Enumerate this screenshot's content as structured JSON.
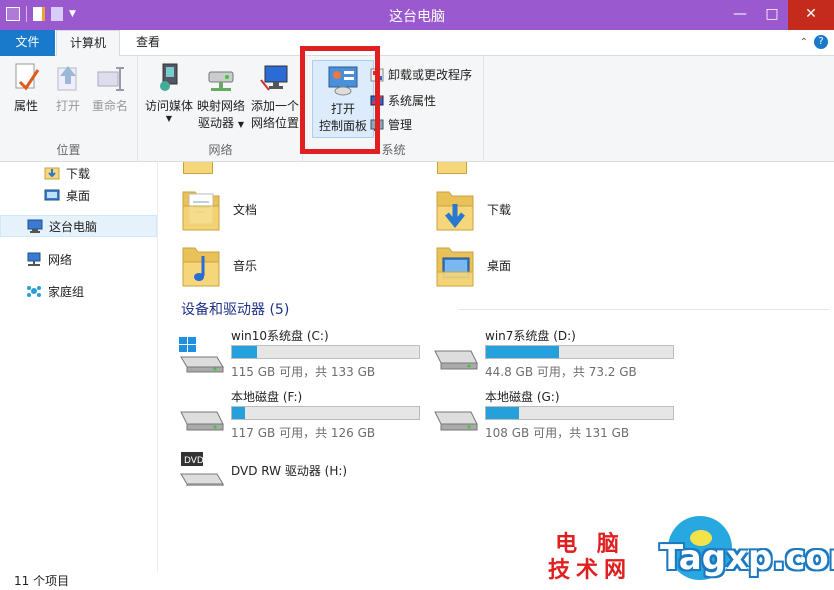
{
  "window": {
    "title": "这台电脑",
    "controls": {
      "minimize": "—",
      "maximize": "□",
      "close": "✕"
    }
  },
  "ribbon_tabs": {
    "file": "文件",
    "computer": "计算机",
    "view": "查看"
  },
  "ribbon": {
    "location_group": {
      "label": "位置",
      "properties": "属性",
      "open": "打开",
      "rename": "重命名"
    },
    "network_group": {
      "label": "网络",
      "access_media": "访问媒体",
      "map_drive_line1": "映射网络",
      "map_drive_line2": "驱动器",
      "add_location_line1": "添加一个",
      "add_location_line2": "网络位置"
    },
    "system_group": {
      "label": "系统",
      "open_cp_line1": "打开",
      "open_cp_line2": "控制面板",
      "uninstall": "卸载或更改程序",
      "system_props": "系统属性",
      "manage": "管理"
    }
  },
  "navpane": {
    "downloads": "下载",
    "desktop": "桌面",
    "this_pc": "这台电脑",
    "network": "网络",
    "homegroup": "家庭组"
  },
  "folders": [
    {
      "name": "文档",
      "icon": "documents-folder-icon"
    },
    {
      "name": "下载",
      "icon": "downloads-folder-icon"
    },
    {
      "name": "音乐",
      "icon": "music-folder-icon"
    },
    {
      "name": "桌面",
      "icon": "desktop-folder-icon"
    }
  ],
  "devices_section": {
    "title": "设备和驱动器 (5)"
  },
  "drives": [
    {
      "name": "win10系统盘 (C:)",
      "info": "115 GB 可用，共 133 GB",
      "used_fraction": 0.135
    },
    {
      "name": "win7系统盘 (D:)",
      "info": "44.8 GB 可用，共 73.2 GB",
      "used_fraction": 0.39
    },
    {
      "name": "本地磁盘 (F:)",
      "info": "117 GB 可用，共 126 GB",
      "used_fraction": 0.07
    },
    {
      "name": "本地磁盘 (G:)",
      "info": "108 GB 可用，共 131 GB",
      "used_fraction": 0.175
    }
  ],
  "dvd": {
    "name": "DVD RW 驱动器 (H:)",
    "badge": "DVD"
  },
  "statusbar": {
    "item_count": "11 个项目"
  },
  "watermark": {
    "cn_line1": "电 脑",
    "cn_line2": "技术网",
    "en": "Tagxp.com"
  },
  "colors": {
    "titlebar": "#9b59d0",
    "file_tab": "#1979ca",
    "drive_fill": "#26a0da",
    "highlight": "#e02020"
  }
}
